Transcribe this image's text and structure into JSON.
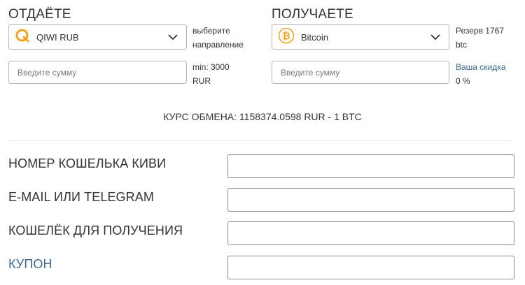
{
  "give": {
    "title": "ОТДАЁТЕ",
    "currency": "QIWI RUB",
    "hint_line1": "выберите",
    "hint_line2": "направление",
    "amount_placeholder": "Введите сумму",
    "limit_line1": "min: 3000",
    "limit_line2": "RUR",
    "icon": "qiwi-logo",
    "icon_color": "#f7a21b"
  },
  "get": {
    "title": "ПОЛУЧАЕТЕ",
    "currency": "Bitcoin",
    "reserve_line1": "Резерв 1767",
    "reserve_line2": "btc",
    "amount_placeholder": "Введите сумму",
    "discount_label": "Ваша скидка",
    "discount_value": "0 %",
    "icon": "bitcoin-logo",
    "icon_color": "#f7a21b"
  },
  "rate": "КУРС ОБМЕНА: 1158374.0598 RUR - 1 BTC",
  "form": {
    "fields": [
      {
        "label": "НОМЕР КОШЕЛЬКА КИВИ",
        "value": ""
      },
      {
        "label": "E-MAIL ИЛИ TELEGRAM",
        "value": ""
      },
      {
        "label": "КОШЕЛЁК ДЛЯ ПОЛУЧЕНИЯ",
        "value": ""
      },
      {
        "label": "КУПОН",
        "value": ""
      }
    ]
  },
  "colors": {
    "accent": "#f7a21b",
    "link": "#3a6b98",
    "border": "#b5b5b5"
  }
}
